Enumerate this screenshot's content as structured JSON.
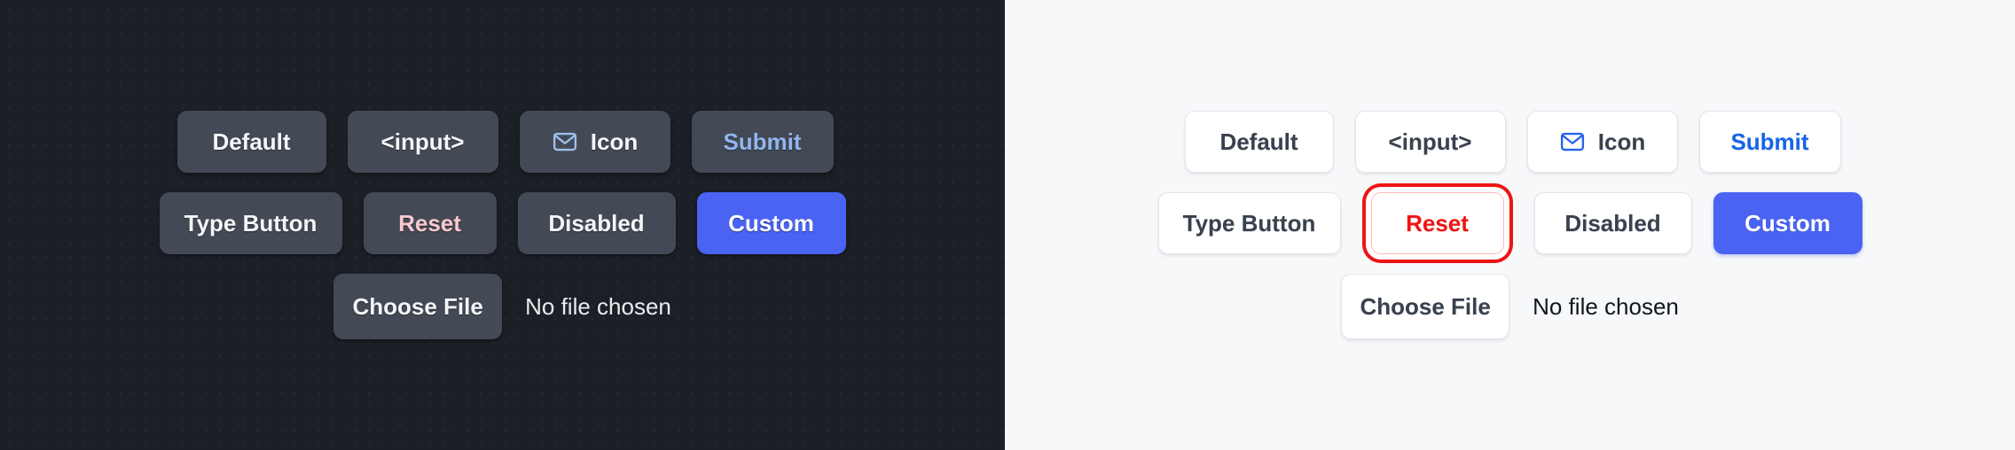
{
  "panels": {
    "dark": {
      "theme_name": "dark",
      "background_color": "#1b1f26",
      "surface_color": "#434a55",
      "text_color": "#f3f5f7",
      "buttons": {
        "default": "Default",
        "input": "<input>",
        "icon": "Icon",
        "submit": "Submit",
        "type_button": "Type Button",
        "reset": "Reset",
        "disabled": "Disabled",
        "custom": "Custom",
        "choose_file": "Choose File"
      },
      "file_status": "No file chosen",
      "accent_colors": {
        "submit_text": "#93b5f0",
        "reset_text": "#f9c8ce",
        "custom_bg": "#4a63f2",
        "icon_stroke": "#9dc0ea"
      }
    },
    "light": {
      "theme_name": "light",
      "background_color": "#f7f8fa",
      "surface_color": "#ffffff",
      "text_color": "#39414e",
      "buttons": {
        "default": "Default",
        "input": "<input>",
        "icon": "Icon",
        "submit": "Submit",
        "type_button": "Type Button",
        "reset": "Reset",
        "disabled": "Disabled",
        "custom": "Custom",
        "choose_file": "Choose File"
      },
      "file_status": "No file chosen",
      "accent_colors": {
        "submit_text": "#1765e8",
        "reset_text": "#f01414",
        "reset_focus_ring": "#ee1414",
        "custom_bg": "#4a63f2",
        "icon_stroke": "#2563eb",
        "border": "#e2e5ea"
      }
    }
  },
  "icons": {
    "envelope": "envelope-icon"
  }
}
